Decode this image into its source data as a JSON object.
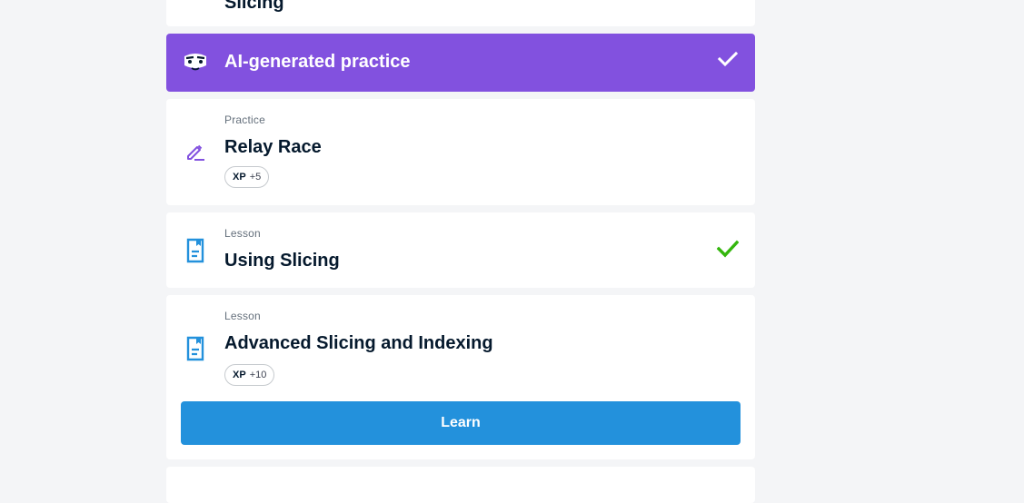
{
  "cards": {
    "top_partial": {
      "title": "Slicing"
    },
    "ai_practice": {
      "title": "AI-generated practice",
      "bg_color": "#8251df",
      "completed": true
    },
    "relay_race": {
      "type": "Practice",
      "title": "Relay Race",
      "xp_label": "XP",
      "xp_value": "+5",
      "icon": "pencil-edit-icon"
    },
    "using_slicing": {
      "type": "Lesson",
      "title": "Using Slicing",
      "completed": true,
      "icon": "document-icon"
    },
    "advanced_slicing": {
      "type": "Lesson",
      "title": "Advanced Slicing and Indexing",
      "xp_label": "XP",
      "xp_value": "+10",
      "button_label": "Learn",
      "icon": "document-icon"
    }
  },
  "colors": {
    "background": "#f4f5f7",
    "accent_purple": "#8251df",
    "button_blue": "#2391dc",
    "check_green": "#03ef62",
    "lesson_icon_blue": "#2391dc"
  }
}
